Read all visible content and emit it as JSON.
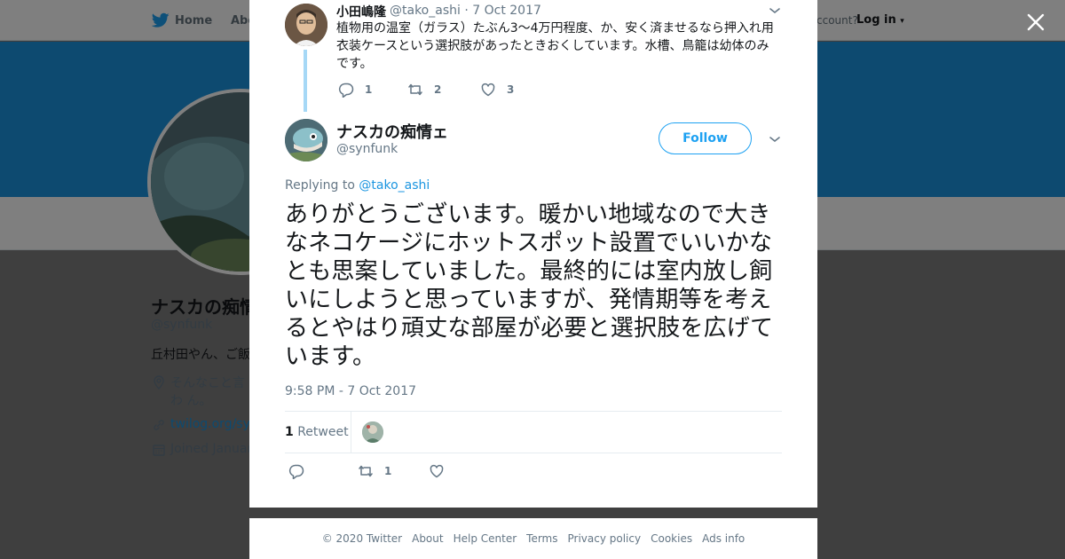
{
  "background": {
    "nav": {
      "home": "Home",
      "about": "Abo",
      "account_question": "ccount?",
      "login": "Log in"
    },
    "profile": {
      "name": "ナスカの痴情",
      "handle": "@synfunk",
      "bio": "丘村田やん、ご飯",
      "location": "そんなこと言わ ん。",
      "link": "twilog.org/synf",
      "joined": "Joined Januar"
    }
  },
  "parent_tweet": {
    "name": "小田嶋隆",
    "handle": "@tako_ashi",
    "date": "· 7 Oct 2017",
    "text": "植物用の温室（ガラス）たぶん3〜4万円程度、か、安く済ませるなら押入れ用衣装ケースという選択肢があったときおくしています。水槽、鳥籠は幼体のみです。",
    "reply_count": "1",
    "retweet_count": "2",
    "like_count": "3"
  },
  "main_tweet": {
    "name": "ナスカの痴情ェ",
    "handle": "@synfunk",
    "follow_label": "Follow",
    "replying_prefix": "Replying to",
    "replying_to": "@tako_ashi",
    "text": "ありがとうございます。暖かい地域なので大きなネコケージにホットスポット設置でいいかなとも思案していました。最終的には室内放し飼いにしようと思っていますが、発情期等を考えるとやはり頑丈な部屋が必要と選択肢を広げています。",
    "timestamp": "9:58 PM - 7 Oct 2017",
    "retweet_stat_count": "1",
    "retweet_stat_label": "Retweet",
    "retweet_action_count": "1"
  },
  "footer": {
    "links": [
      "© 2020 Twitter",
      "About",
      "Help Center",
      "Terms",
      "Privacy policy",
      "Cookies",
      "Ads info"
    ]
  },
  "colors": {
    "accent": "#1da1f2",
    "banner": "#1b95e0",
    "thread_line": "#a6d8f6",
    "muted": "#657786"
  }
}
